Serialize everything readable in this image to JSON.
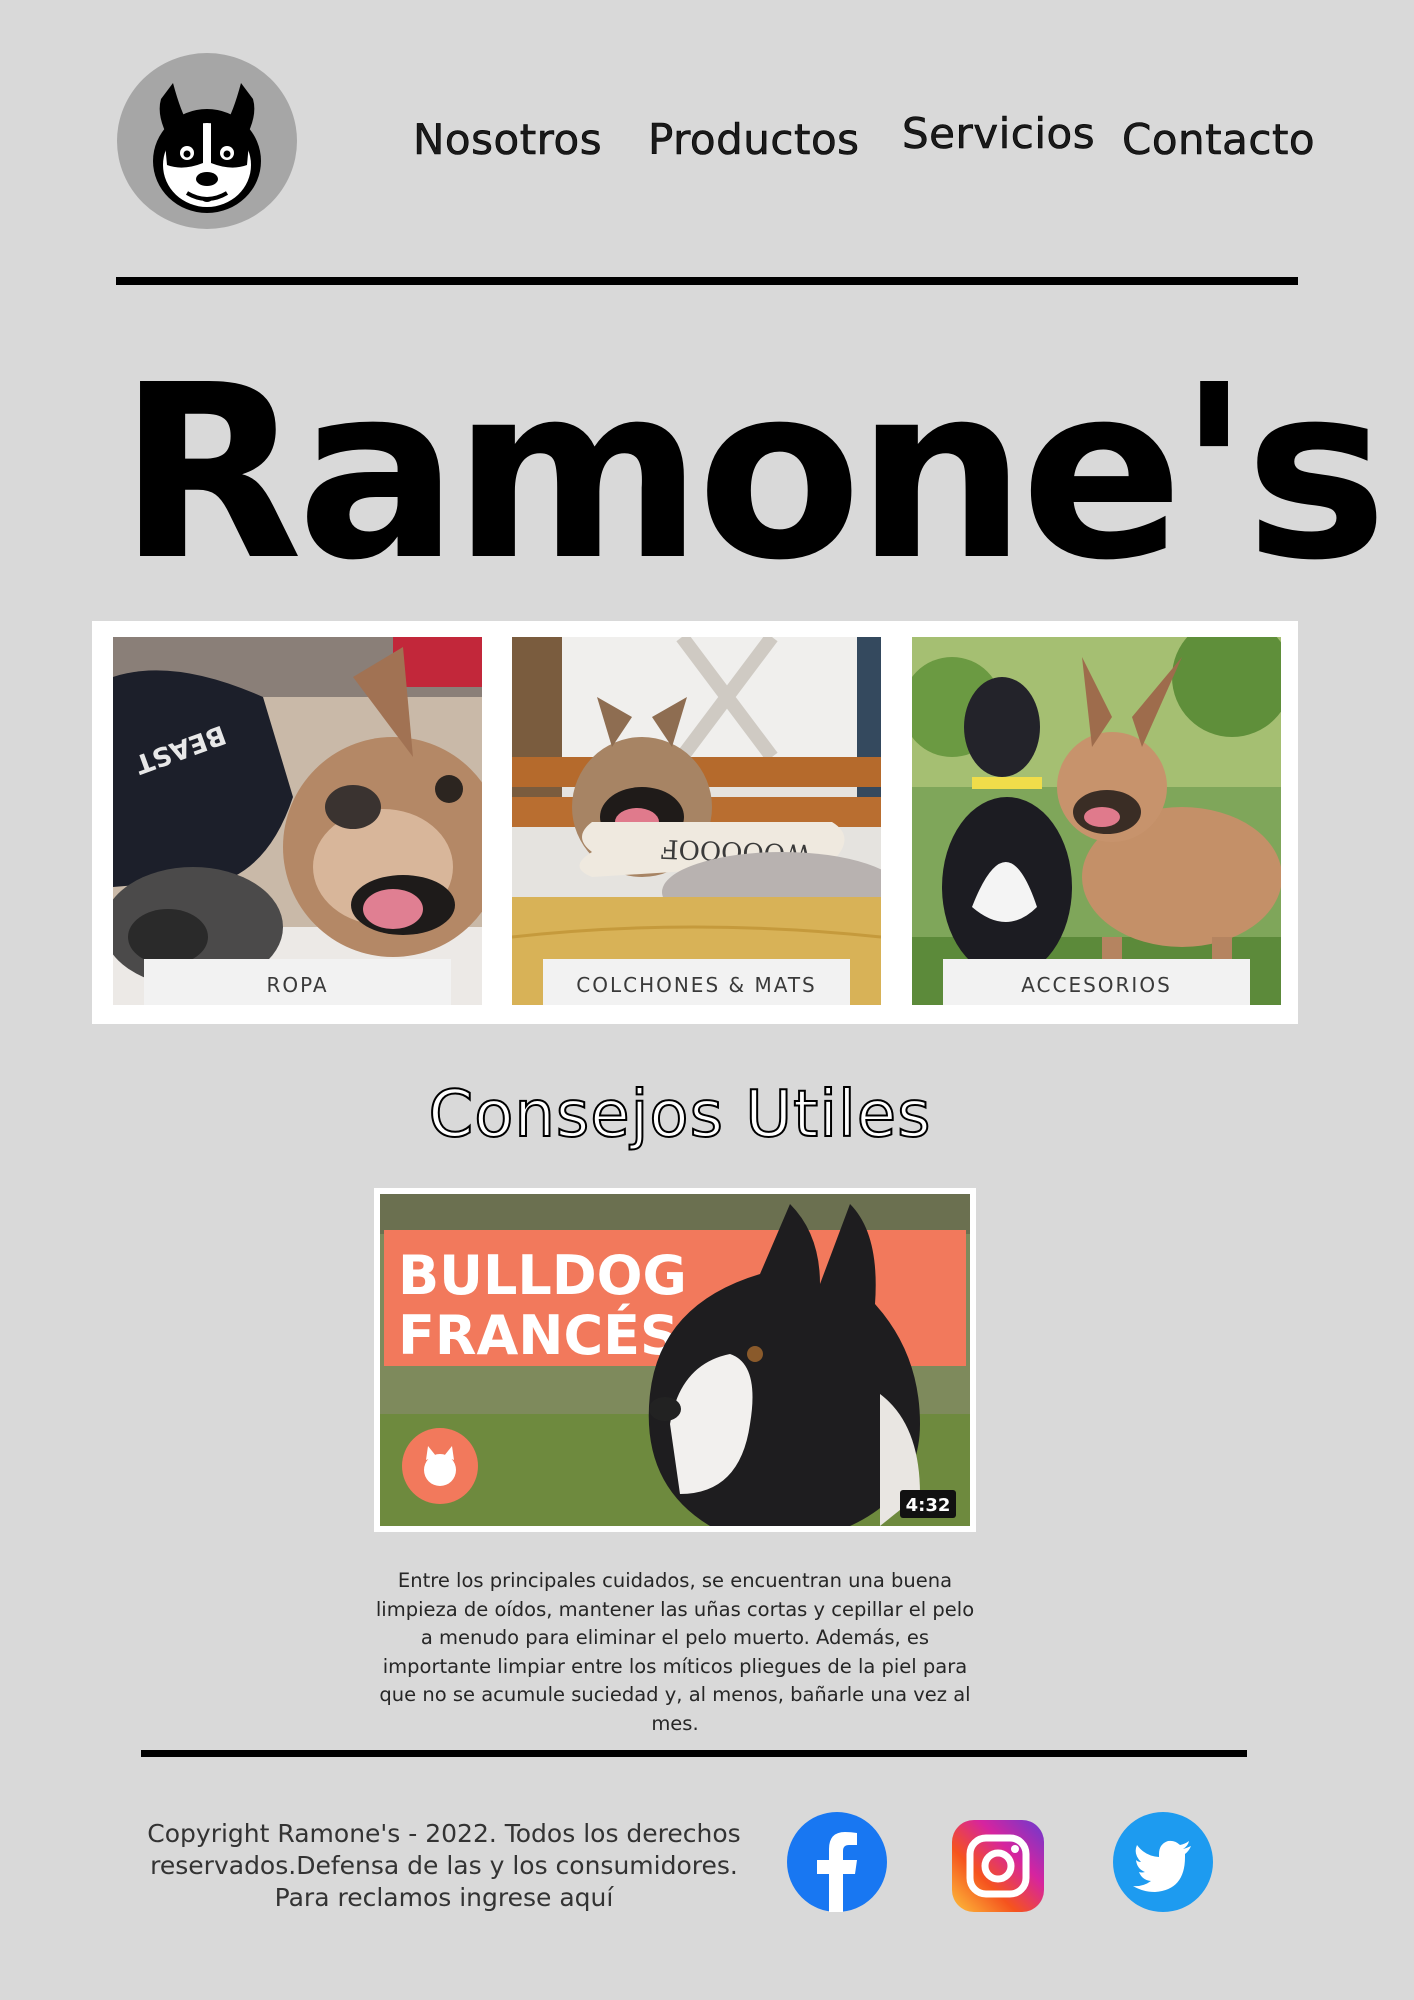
{
  "nav": {
    "items": [
      {
        "label": "Nosotros"
      },
      {
        "label": "Productos"
      },
      {
        "label": "Servicios"
      },
      {
        "label": "Contacto"
      }
    ]
  },
  "brand": {
    "title": "Ramone's"
  },
  "categories": [
    {
      "label": "ROPA"
    },
    {
      "label": "COLCHONES & MATS"
    },
    {
      "label": "ACCESORIOS"
    }
  ],
  "tips": {
    "title": "Consejos Utiles",
    "video": {
      "headline_line1": "BULLDOG",
      "headline_line2": "FRANCÉS",
      "duration": "4:32"
    },
    "body": "Entre los principales cuidados, se encuentran una buena limpieza de oídos, mantener las uñas cortas y cepillar el pelo a menudo para eliminar el pelo muerto. Además, es importante limpiar entre los míticos pliegues de la piel para que no se acumule suciedad y, al menos, bañarle una vez al mes."
  },
  "footer": {
    "copyright": "Copyright Ramone's - 2022. Todos los derechos reservados.Defensa de las y los consumidores. Para reclamos ingrese aquí",
    "social": [
      {
        "icon": "facebook-icon",
        "color": "#1877f2"
      },
      {
        "icon": "instagram-icon",
        "color": "#d6249f"
      },
      {
        "icon": "twitter-icon",
        "color": "#1d9bf0"
      }
    ]
  },
  "colors": {
    "background": "#d9d9d9",
    "logo_circle": "#a6a6a6",
    "video_banner": "#f2795c"
  }
}
